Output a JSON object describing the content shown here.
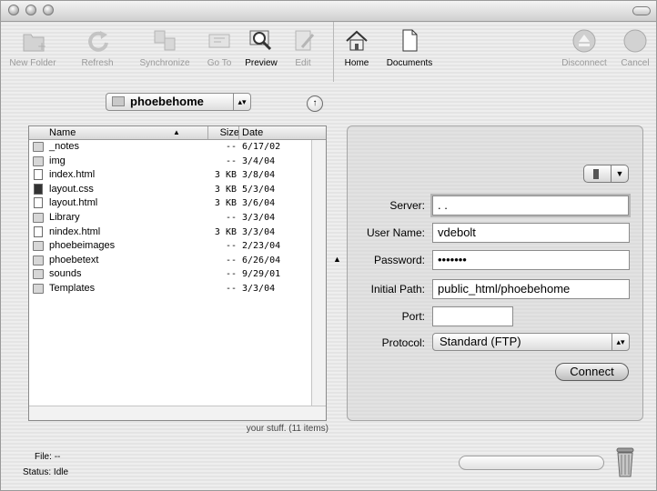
{
  "toolbar": {
    "new_folder": "New Folder",
    "refresh": "Refresh",
    "synchronize": "Synchronize",
    "go_to": "Go To",
    "preview": "Preview",
    "edit": "Edit",
    "home": "Home",
    "documents": "Documents",
    "disconnect": "Disconnect",
    "cancel": "Cancel"
  },
  "local": {
    "folder_popup": "phoebehome",
    "columns": {
      "name": "Name",
      "size": "Size",
      "date": "Date"
    },
    "files": [
      {
        "name": "_notes",
        "size": "--",
        "date": "6/17/02",
        "icon": "folder-icon"
      },
      {
        "name": "img",
        "size": "--",
        "date": "3/4/04",
        "icon": "folder-icon"
      },
      {
        "name": "index.html",
        "size": "3 KB",
        "date": "3/8/04",
        "icon": "html-file-icon"
      },
      {
        "name": "layout.css",
        "size": "3 KB",
        "date": "5/3/04",
        "icon": "css-file-icon"
      },
      {
        "name": "layout.html",
        "size": "3 KB",
        "date": "3/6/04",
        "icon": "html-file-icon"
      },
      {
        "name": "Library",
        "size": "--",
        "date": "3/3/04",
        "icon": "folder-icon"
      },
      {
        "name": "nindex.html",
        "size": "3 KB",
        "date": "3/3/04",
        "icon": "html-file-icon"
      },
      {
        "name": "phoebeimages",
        "size": "--",
        "date": "2/23/04",
        "icon": "folder-icon"
      },
      {
        "name": "phoebetext",
        "size": "--",
        "date": "6/26/04",
        "icon": "folder-icon"
      },
      {
        "name": "sounds",
        "size": "--",
        "date": "9/29/01",
        "icon": "folder-icon"
      },
      {
        "name": "Templates",
        "size": "--",
        "date": "3/3/04",
        "icon": "folder-icon"
      }
    ],
    "summary": "your stuff. (11 items)"
  },
  "status": {
    "file_label": "File:",
    "file_value": "--",
    "status_label": "Status:",
    "status_value": "Idle"
  },
  "connection": {
    "server_label": "Server:",
    "server_value": "  .    .",
    "username_label": "User Name:",
    "username_value": "vdebolt",
    "password_label": "Password:",
    "password_value": "•••••••",
    "initial_path_label": "Initial Path:",
    "initial_path_value": "public_html/phoebehome",
    "port_label": "Port:",
    "port_value": "",
    "protocol_label": "Protocol:",
    "protocol_value": "Standard (FTP)",
    "connect_button": "Connect"
  }
}
